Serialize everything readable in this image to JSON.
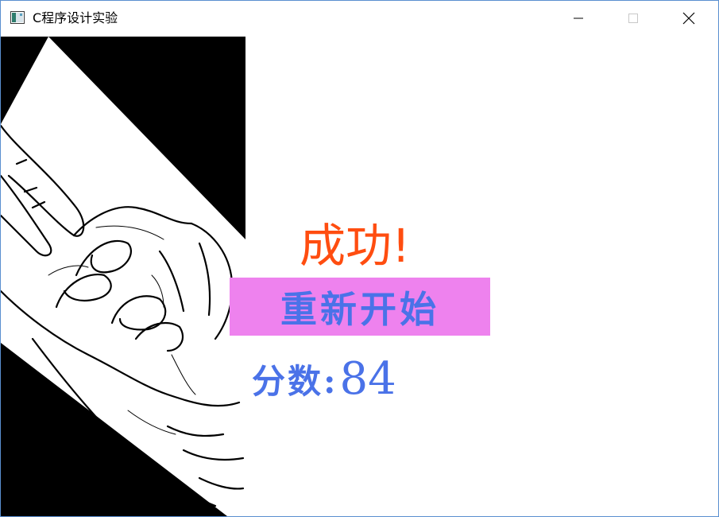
{
  "window": {
    "title": "C程序设计实验",
    "controls": {
      "minimize_icon": "minimize-icon",
      "maximize_icon": "maximize-icon",
      "close_icon": "close-icon"
    }
  },
  "game": {
    "result_text": "成功!",
    "restart_label": "重新开始",
    "score_label": "分数:",
    "score_value": "84",
    "image": "hand-victory-sketch"
  },
  "colors": {
    "result": "#ff4d10",
    "restart_bg": "#ee82ee",
    "text_blue": "#4a72e8"
  }
}
